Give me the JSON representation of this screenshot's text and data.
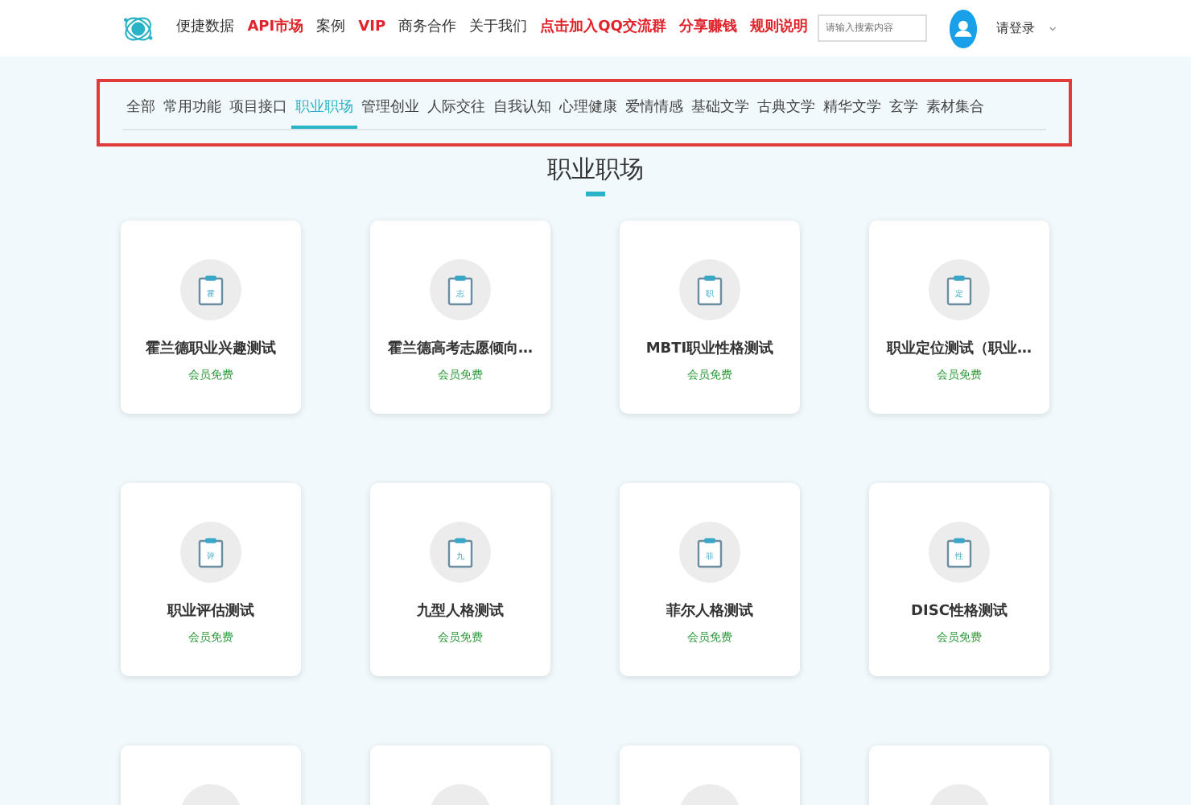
{
  "header": {
    "nav": [
      {
        "label": "便捷数据",
        "kind": "plain"
      },
      {
        "label": "API市场",
        "kind": "highlight"
      },
      {
        "label": "案例",
        "kind": "plain"
      },
      {
        "label": "VIP",
        "kind": "highlight"
      },
      {
        "label": "商务合作",
        "kind": "plain"
      },
      {
        "label": "关于我们",
        "kind": "plain"
      },
      {
        "label": "点击加入QQ交流群",
        "kind": "highlight"
      },
      {
        "label": "分享赚钱",
        "kind": "highlight"
      },
      {
        "label": "规则说明",
        "kind": "highlight"
      }
    ],
    "search": {
      "placeholder": "请输入搜索内容"
    },
    "user": {
      "label": "请登录"
    }
  },
  "tabs": [
    {
      "label": "全部",
      "selected": false
    },
    {
      "label": "常用功能",
      "selected": false
    },
    {
      "label": "项目接口",
      "selected": false
    },
    {
      "label": "职业职场",
      "selected": true
    },
    {
      "label": "管理创业",
      "selected": false
    },
    {
      "label": "人际交往",
      "selected": false
    },
    {
      "label": "自我认知",
      "selected": false
    },
    {
      "label": "心理健康",
      "selected": false
    },
    {
      "label": "爱情情感",
      "selected": false
    },
    {
      "label": "基础文学",
      "selected": false
    },
    {
      "label": "古典文学",
      "selected": false
    },
    {
      "label": "精华文学",
      "selected": false
    },
    {
      "label": "玄学",
      "selected": false
    },
    {
      "label": "素材集合",
      "selected": false
    }
  ],
  "section_title": "职业职场",
  "cards": [
    {
      "kind": "full",
      "icon_char": "霍",
      "title": "霍兰德职业兴趣测试",
      "tag": "会员免费"
    },
    {
      "kind": "full",
      "icon_char": "志",
      "title": "霍兰德高考志愿倾向…",
      "tag": "会员免费"
    },
    {
      "kind": "full",
      "icon_char": "职",
      "title": "MBTI职业性格测试",
      "tag": "会员免费"
    },
    {
      "kind": "full",
      "icon_char": "定",
      "title": "职业定位测试（职业…",
      "tag": "会员免费"
    },
    {
      "kind": "full",
      "icon_char": "评",
      "title": "职业评估测试",
      "tag": "会员免费"
    },
    {
      "kind": "full",
      "icon_char": "九",
      "title": "九型人格测试",
      "tag": "会员免费"
    },
    {
      "kind": "full",
      "icon_char": "菲",
      "title": "菲尔人格测试",
      "tag": "会员免费"
    },
    {
      "kind": "full",
      "icon_char": "性",
      "title": "DISC性格测试",
      "tag": "会员免费"
    },
    {
      "kind": "cut"
    },
    {
      "kind": "cut"
    },
    {
      "kind": "cut"
    },
    {
      "kind": "cut"
    }
  ]
}
